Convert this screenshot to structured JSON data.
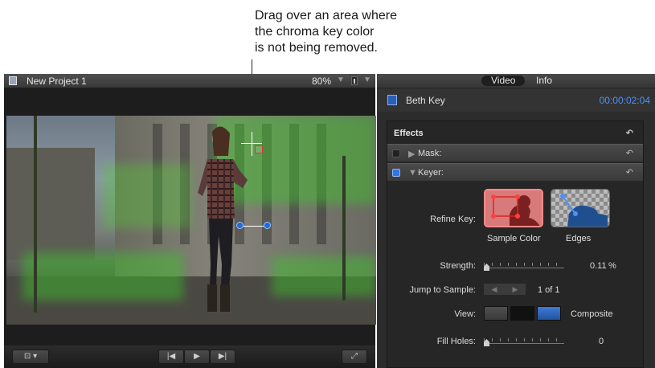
{
  "callout": {
    "line1": "Drag over an area where",
    "line2": "the chroma key color",
    "line3": "is not being removed."
  },
  "viewer": {
    "title": "New Project 1",
    "zoom": "80%",
    "icons": [
      "film-icon",
      "crop-icon",
      "play-icon",
      "skip-back-icon",
      "skip-forward-icon",
      "fullscreen-icon"
    ]
  },
  "inspector": {
    "tabs": [
      "Video",
      "Info"
    ],
    "clip_name": "Beth Key",
    "timecode": "00:00:02:04",
    "effects_label": "Effects",
    "mask_label": "Mask:",
    "keyer_label": "Keyer:",
    "refine_key_label": "Refine Key:",
    "sample_color_label": "Sample Color",
    "edges_label": "Edges",
    "strength_label": "Strength:",
    "strength_value": "0.11",
    "strength_unit": "%",
    "jump_label": "Jump to Sample:",
    "jump_value": "1 of 1",
    "view_label": "View:",
    "view_value": "Composite",
    "fill_holes_label": "Fill Holes:",
    "fill_holes_value": "0",
    "colors": {
      "accent_blue": "#4c90ff",
      "sample_red": "#d23a3a",
      "keyer_check": "#2f76e6"
    }
  }
}
